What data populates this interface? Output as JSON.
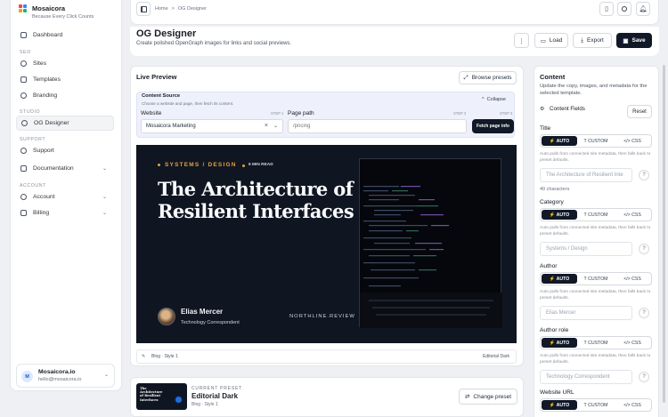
{
  "brand": {
    "name": "Mosaicora",
    "tagline": "Because Every Click Counts"
  },
  "nav": {
    "dashboard": "Dashboard",
    "seo_label": "SEO",
    "sites": "Sites",
    "templates": "Templates",
    "branding": "Branding",
    "studio_label": "STUDIO",
    "og_designer": "OG Designer",
    "support_label": "SUPPORT",
    "support": "Support",
    "documentation": "Documentation",
    "account_label": "ACCOUNT",
    "account": "Account",
    "billing": "Billing"
  },
  "user": {
    "initial": "M",
    "name": "Mosaicora.io",
    "email": "hello@mosaicora.io"
  },
  "breadcrumb": {
    "home": "Home",
    "sep": ">",
    "current": "OG Designer"
  },
  "page": {
    "title": "OG Designer",
    "subtitle": "Create polished OpenGraph images for links and social previews."
  },
  "actions": {
    "more": "⋮",
    "load": "Load",
    "export": "Export",
    "save": "Save"
  },
  "preview": {
    "title": "Live Preview",
    "browse": "Browse presets",
    "source_title": "Content Source",
    "source_sub": "Choose a website and page, then fetch its content.",
    "collapse": "Collapse",
    "website_label": "Website",
    "step1": "STEP 1",
    "website_value": "Mosaicora Marketing",
    "path_label": "Page path",
    "step2": "STEP 2",
    "step3": "STEP 3",
    "path_placeholder": "/pricing",
    "fetch": "Fetch page info",
    "footer_left": "Blog · Style 1",
    "footer_right": "Editorial Dark"
  },
  "og": {
    "kicker": "SYSTEMS / DESIGN",
    "read_time": "6 MIN READ",
    "headline_1": "The Architecture of",
    "headline_2": "Resilient Interfaces",
    "author": "Elias Mercer",
    "role": "Technology Correspondent",
    "site": "NORTHLINE.REVIEW"
  },
  "current_preset": {
    "label": "CURRENT PRESET",
    "name": "Editorial Dark",
    "sub": "Blog · Style 1",
    "change": "Change preset",
    "thumb_title": "The Architecture of Resilient Interfaces"
  },
  "content": {
    "title": "Content",
    "desc": "Update the copy, images, and metadata for the selected template.",
    "fields_label": "Content Fields",
    "reset": "Reset",
    "modes": {
      "auto": "AUTO",
      "custom": "CUSTOM",
      "css": "CSS"
    },
    "help": "Auto pulls from connected site metadata, then falls back to preset defaults.",
    "fields": [
      {
        "label": "Title",
        "value": "The Architecture of Resilient Inte",
        "count": "40 characters"
      },
      {
        "label": "Category",
        "value": "Systems / Design"
      },
      {
        "label": "Author",
        "value": "Elias Mercer"
      },
      {
        "label": "Author role",
        "value": "Technology Correspondent"
      },
      {
        "label": "Website URL"
      }
    ]
  },
  "colors": {
    "accent": "#e0a43a",
    "dark": "#111827",
    "og_bg": "#101522"
  }
}
